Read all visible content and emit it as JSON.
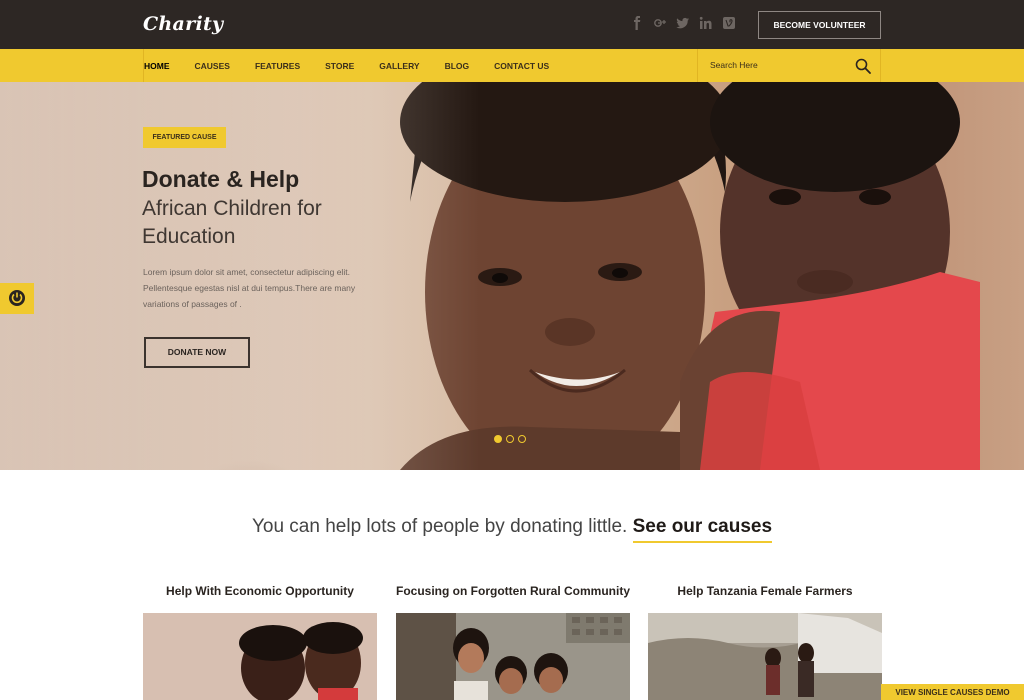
{
  "header": {
    "logo": "Charity",
    "social_icons": [
      "facebook-icon",
      "google-plus-icon",
      "twitter-icon",
      "linkedin-icon",
      "vine-icon"
    ],
    "volunteer_label": "BECOME VOLUNTEER"
  },
  "nav": {
    "items": [
      "HOME",
      "CAUSES",
      "FEATURES",
      "STORE",
      "GALLERY",
      "BLOG",
      "CONTACT US"
    ],
    "active": "HOME",
    "search_placeholder": "Search Here"
  },
  "hero": {
    "badge": "FEATURED CAUSE",
    "title": "Donate & Help",
    "subtitle": "African Children for Education",
    "text": "Lorem ipsum dolor sit amet, consectetur adipiscing elit. Pellentesque egestas nisl at dui tempus.There are many variations of passages of .",
    "donate_label": "DONATE NOW",
    "slides_total": 3,
    "slide_active": 1
  },
  "causes": {
    "tagline": "You can help lots of people by donating little.",
    "tagline_link": "See our causes",
    "items": [
      {
        "title": "Help With Economic Opportunity"
      },
      {
        "title": "Focusing on Forgotten Rural Community"
      },
      {
        "title": "Help Tanzania Female Farmers"
      }
    ],
    "demo_label": "VIEW SINGLE CAUSES DEMO"
  },
  "colors": {
    "accent": "#f0c92f",
    "topbar": "#2d2724",
    "text_dark": "#2a2420"
  }
}
